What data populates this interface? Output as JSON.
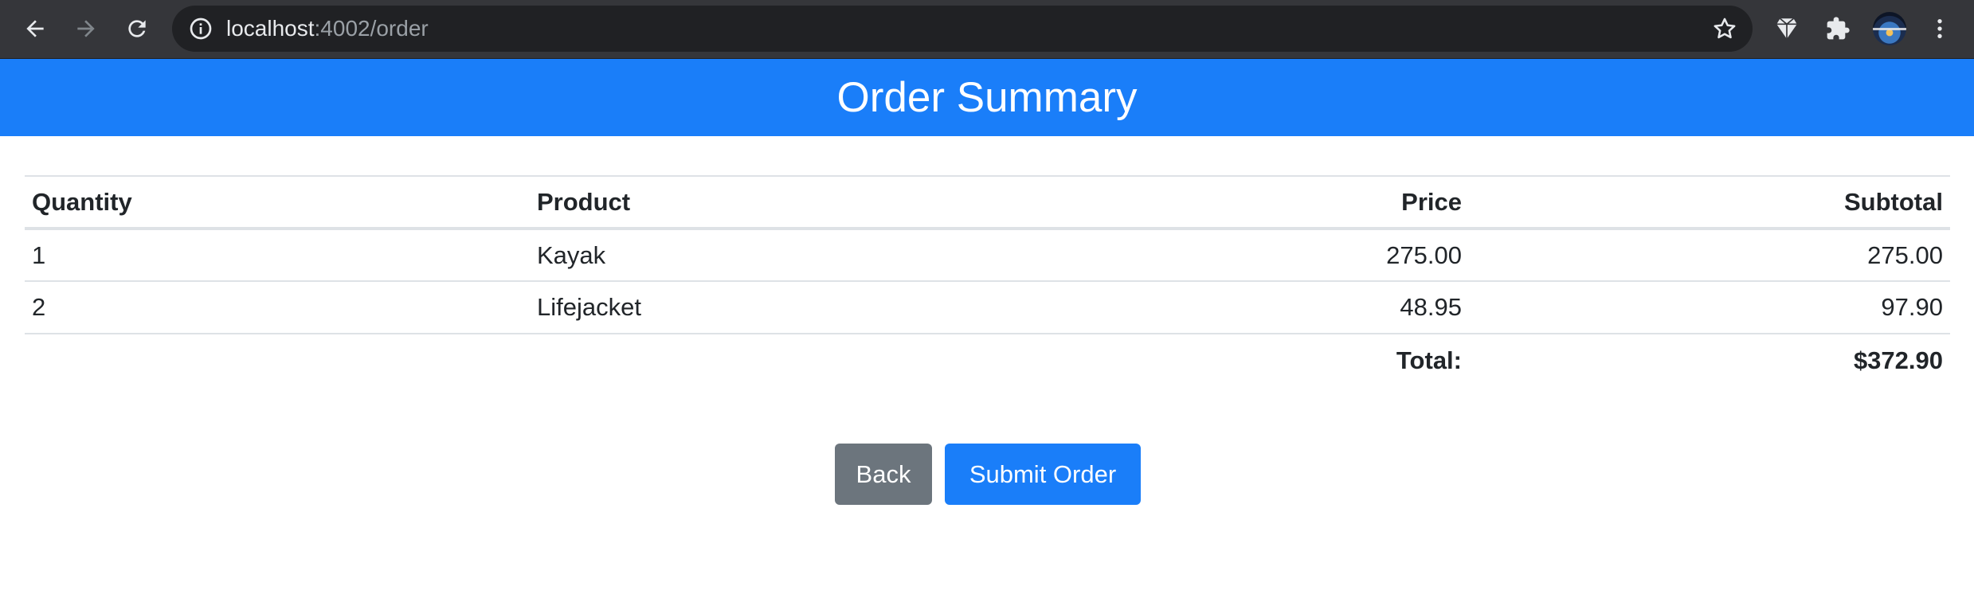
{
  "browser": {
    "url_host": "localhost",
    "url_path": ":4002/order"
  },
  "page": {
    "title": "Order Summary"
  },
  "table": {
    "headers": {
      "quantity": "Quantity",
      "product": "Product",
      "price": "Price",
      "subtotal": "Subtotal"
    },
    "rows": [
      {
        "quantity": "1",
        "product": "Kayak",
        "price": "275.00",
        "subtotal": "275.00"
      },
      {
        "quantity": "2",
        "product": "Lifejacket",
        "price": "48.95",
        "subtotal": "97.90"
      }
    ],
    "total_label": "Total:",
    "total_value": "$372.90"
  },
  "actions": {
    "back_label": "Back",
    "submit_label": "Submit Order"
  },
  "colors": {
    "primary": "#1a7ef9",
    "secondary": "#6c757d",
    "chrome_bg": "#35363a"
  },
  "icons": [
    "back-arrow-icon",
    "forward-arrow-icon",
    "reload-icon",
    "info-icon",
    "star-icon",
    "brave-shield-icon",
    "puzzle-extension-icon",
    "avatar",
    "kebab-menu-icon"
  ]
}
